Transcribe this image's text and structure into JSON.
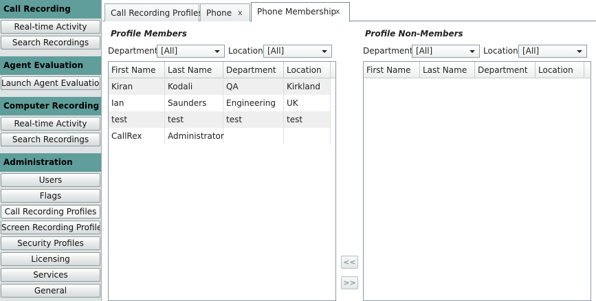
{
  "sidebar": {
    "sections": [
      {
        "title": "Call Recording",
        "items": [
          "Real-time Activity",
          "Search Recordings"
        ]
      },
      {
        "title": "Agent Evaluation",
        "items": [
          "Launch Agent Evaluation"
        ]
      },
      {
        "title": "Computer Recording",
        "items": [
          "Real-time Activity",
          "Search Recordings"
        ]
      },
      {
        "title": "Administration",
        "items": [
          "Users",
          "Flags",
          "Call Recording Profiles",
          "Screen Recording Profiles",
          "Security Profiles",
          "Licensing",
          "Services",
          "General"
        ]
      }
    ]
  },
  "tabs": [
    {
      "label": "Call Recording Profiles"
    },
    {
      "label": "Phone",
      "close": "x"
    },
    {
      "label": "Phone Membership",
      "close": "x"
    }
  ],
  "members": {
    "title": "Profile Members",
    "department_label": "Department",
    "department_value": "[All]",
    "location_label": "Location",
    "location_value": "[All]",
    "columns": [
      "First Name",
      "Last Name",
      "Department",
      "Location"
    ],
    "rows": [
      [
        "Kiran",
        "Kodali",
        "QA",
        "Kirkland"
      ],
      [
        "Ian",
        "Saunders",
        "Engineering",
        "UK"
      ],
      [
        "test",
        "test",
        "test",
        "test"
      ],
      [
        "CallRex",
        "Administrator",
        "",
        ""
      ]
    ]
  },
  "nonmembers": {
    "title": "Profile Non-Members",
    "department_label": "Department",
    "department_value": "[All]",
    "location_label": "Location",
    "location_value": "[All]",
    "columns": [
      "First Name",
      "Last Name",
      "Department",
      "Location"
    ]
  },
  "move": {
    "add_label": "<<",
    "remove_label": ">>"
  }
}
